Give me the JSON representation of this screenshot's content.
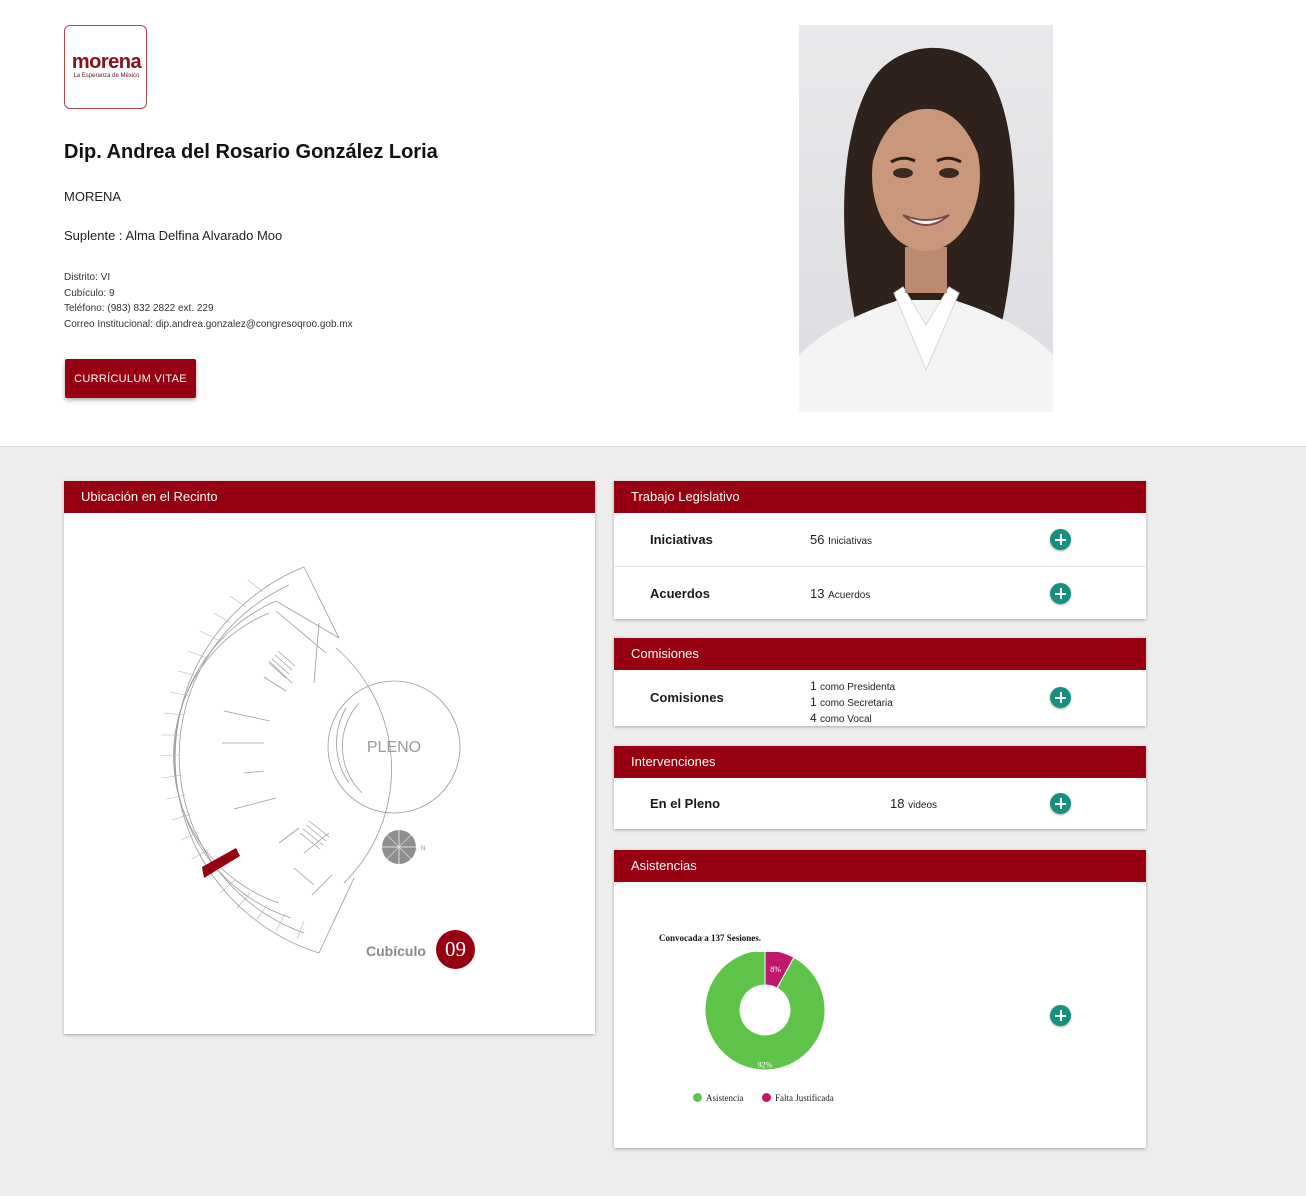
{
  "profile": {
    "logo_word": "morena",
    "logo_tagline": "La Esperanza de México",
    "name": "Dip. Andrea del Rosario González Loria",
    "party": "MORENA",
    "suplente": "Suplente : Alma Delfina Alvarado Moo",
    "distrito": "Distrito: VI",
    "cubiculo": "Cubículo: 9",
    "telefono": "Teléfono: (983) 832 2822 ext. 229",
    "correo": "Correo Institucional: dip.andrea.gonzalez@congresoqroo.gob.mx",
    "cv_button": "CURRÍCULUM VITAE"
  },
  "ubicacion": {
    "header": "Ubicación en el Recinto",
    "pleno_label": "PLENO",
    "compass_label": "N",
    "cubiculo_label": "Cubículo",
    "cubiculo_number": "09",
    "highlight_color": "#960010"
  },
  "trabajo": {
    "header": "Trabajo Legislativo",
    "rows": [
      {
        "label": "Iniciativas",
        "count": "56",
        "unit": "Iniciativas",
        "icon": "plus-circle-icon"
      },
      {
        "label": "Acuerdos",
        "count": "13",
        "unit": "Acuerdos",
        "icon": "plus-circle-icon"
      }
    ]
  },
  "comisiones": {
    "header": "Comisiones",
    "label": "Comisiones",
    "lines": [
      {
        "count": "1",
        "text": "como Presidenta"
      },
      {
        "count": "1",
        "text": "como Secretaria"
      },
      {
        "count": "4",
        "text": "como Vocal"
      }
    ]
  },
  "intervenciones": {
    "header": "Intervenciones",
    "label": "En el Pleno",
    "count": "18",
    "unit": "videos"
  },
  "asistencias": {
    "header": "Asistencias"
  },
  "colors": {
    "brand": "#960010",
    "action": "#17907f",
    "asistencia": "#5ec349",
    "falta": "#c2186b"
  },
  "chart_data": {
    "type": "pie",
    "title": "Convocada a 137 Sesiones.",
    "categories": [
      "Asistencia",
      "Falta Justificada"
    ],
    "values": [
      92,
      8
    ],
    "labels": [
      "92%",
      "8%"
    ],
    "colors": [
      "#5ec349",
      "#c2186b"
    ],
    "legend": "bottom"
  }
}
